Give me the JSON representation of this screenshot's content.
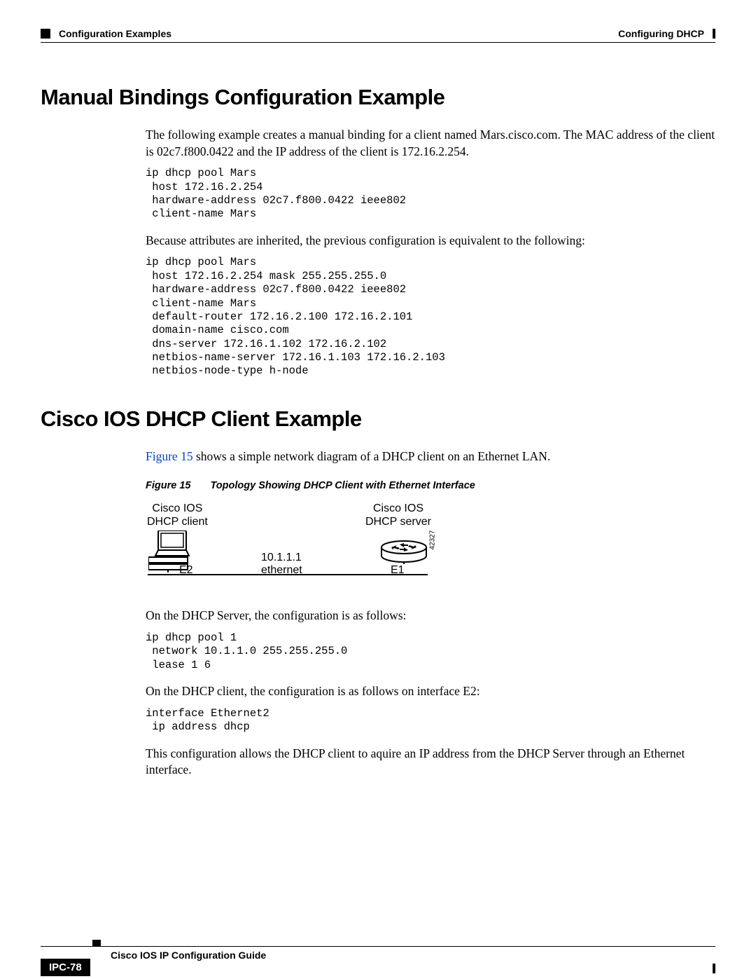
{
  "header": {
    "left": "Configuration Examples",
    "right": "Configuring DHCP"
  },
  "section1": {
    "title": "Manual Bindings Configuration Example",
    "intro": "The following example creates a manual binding for a client named Mars.cisco.com. The MAC address of the client is 02c7.f800.0422 and the IP address of the client is 172.16.2.254.",
    "code1": "ip dhcp pool Mars\n host 172.16.2.254\n hardware-address 02c7.f800.0422 ieee802\n client-name Mars",
    "bridge": "Because attributes are inherited, the previous configuration is equivalent to the following:",
    "code2": "ip dhcp pool Mars\n host 172.16.2.254 mask 255.255.255.0\n hardware-address 02c7.f800.0422 ieee802\n client-name Mars\n default-router 172.16.2.100 172.16.2.101\n domain-name cisco.com\n dns-server 172.16.1.102 172.16.2.102\n netbios-name-server 172.16.1.103 172.16.2.103\n netbios-node-type h-node"
  },
  "section2": {
    "title": "Cisco IOS DHCP Client Example",
    "intro_link": "Figure 15",
    "intro_rest": " shows a simple network diagram of a DHCP client on an Ethernet LAN.",
    "figure_num": "Figure 15",
    "figure_title": "Topology Showing DHCP Client with Ethernet Interface",
    "diagram": {
      "client_label": "Cisco IOS\nDHCP client",
      "server_label": "Cisco IOS\nDHCP server",
      "ip": "10.1.1.1",
      "eth": "ethernet",
      "e1": "E1",
      "e2": "E2",
      "fig_id": "42327"
    },
    "p_server": "On the DHCP Server, the configuration is as follows:",
    "code_server": "ip dhcp pool 1\n network 10.1.1.0 255.255.255.0\n lease 1 6",
    "p_client": "On the DHCP client, the configuration is as follows on interface E2:",
    "code_client": "interface Ethernet2\n ip address dhcp",
    "p_conclusion": "This configuration allows the DHCP client to aquire an IP address from the DHCP Server through an Ethernet interface."
  },
  "footer": {
    "guide": "Cisco IOS IP Configuration Guide",
    "page": "IPC-78"
  }
}
